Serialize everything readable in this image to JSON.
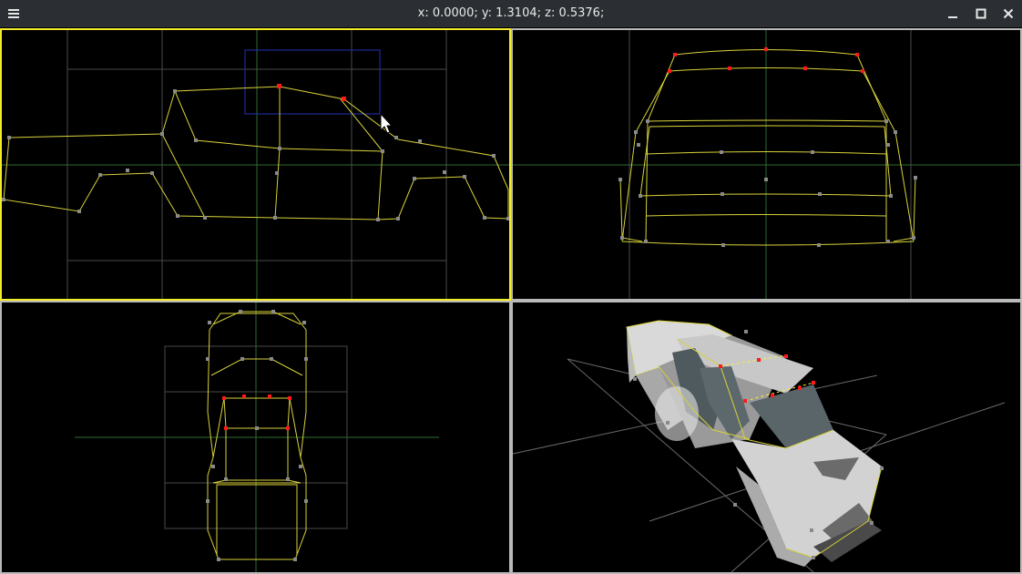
{
  "window": {
    "coords_text": "x: 0.0000; y: 1.3104; z: 0.5376;"
  },
  "icons": {
    "menu": "hamburger-menu-icon",
    "minimize": "minimize-icon",
    "maximize": "maximize-icon",
    "close": "close-icon"
  },
  "colors": {
    "wire": "#d8d23a",
    "vertex": "#8a8a8a",
    "selected_vertex": "#ff1a1a",
    "active_frame": "#f2ec2a",
    "grid": "#5a5a5a",
    "axis": "#2f6b2f",
    "selection_box": "#1f2fb8"
  },
  "viewports": [
    {
      "view": "side",
      "active": true
    },
    {
      "view": "front",
      "active": false
    },
    {
      "view": "top",
      "active": false
    },
    {
      "view": "perspective",
      "active": false
    }
  ]
}
